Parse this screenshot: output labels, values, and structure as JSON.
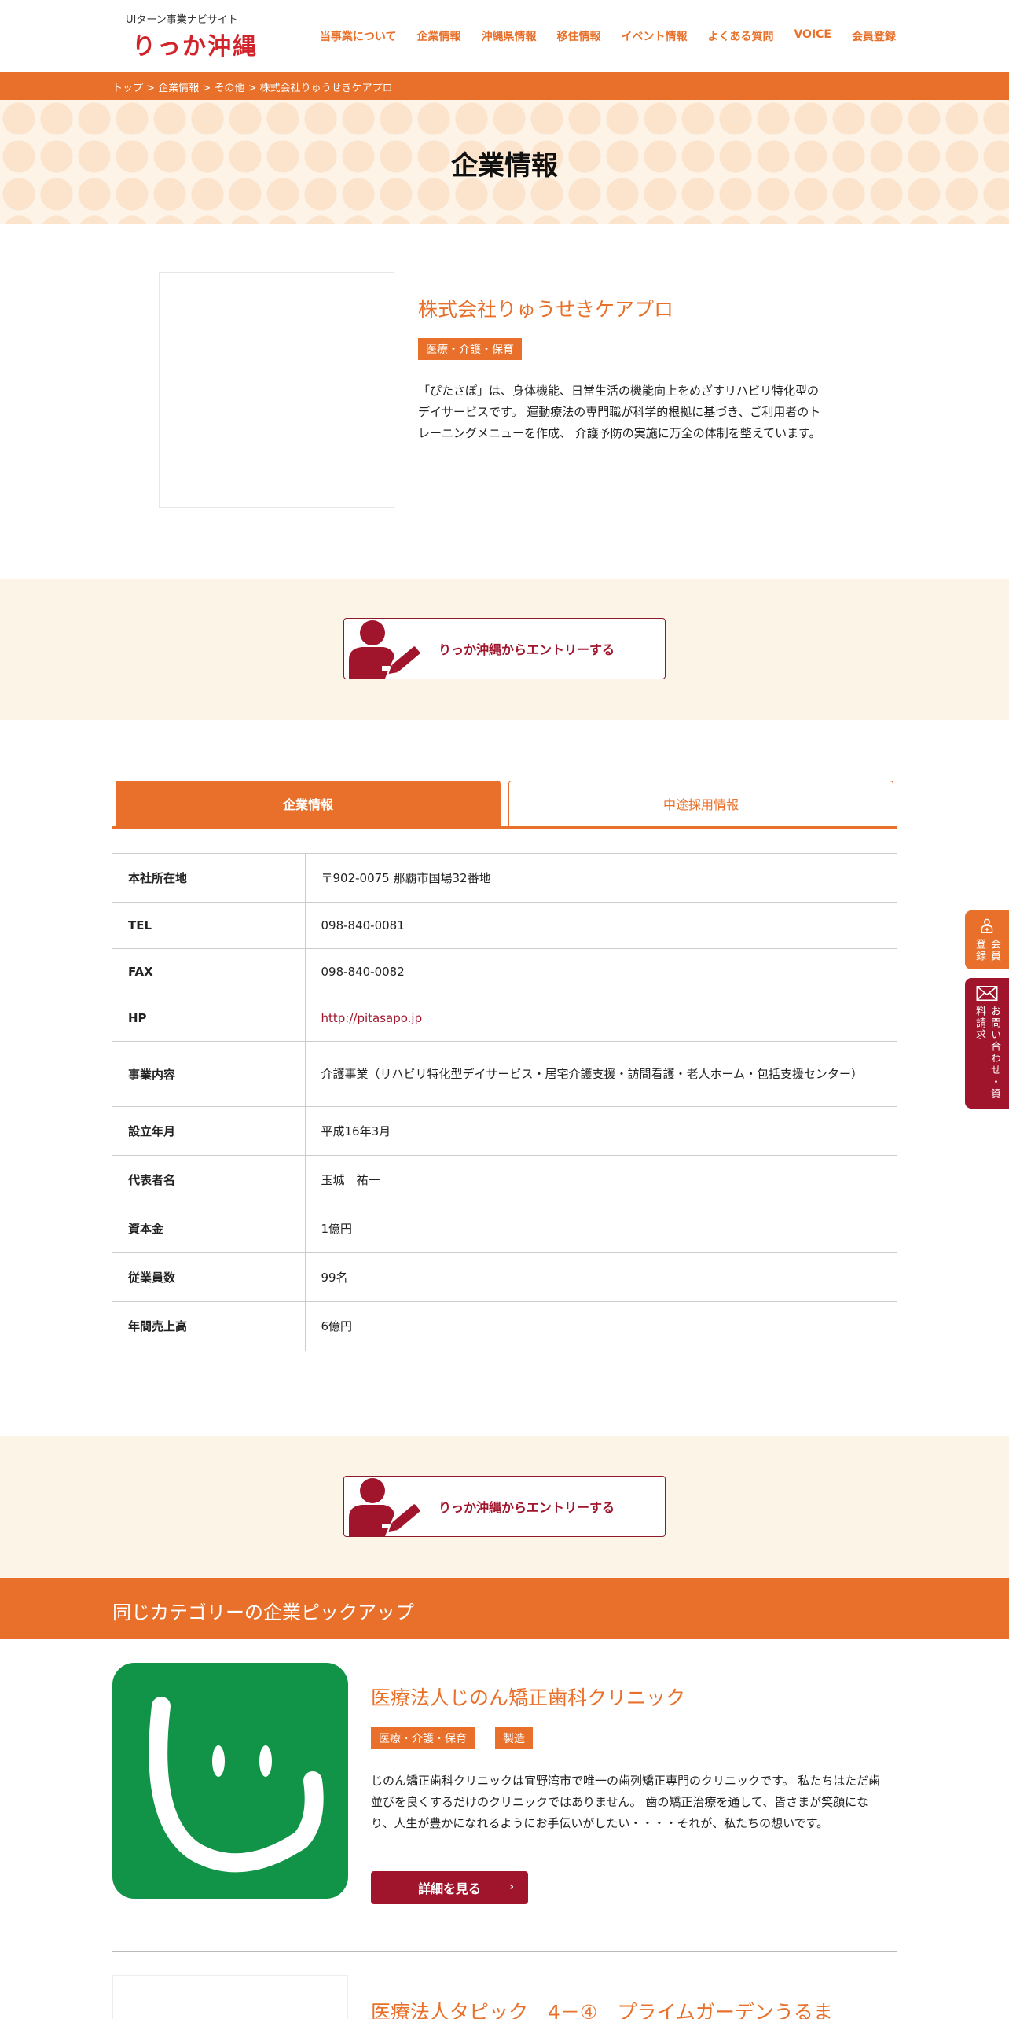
{
  "header": {
    "logo_sub": "UIターン事業ナビサイト",
    "logo_main": "りっか沖縄",
    "nav": [
      "当事業について",
      "企業情報",
      "沖縄県情報",
      "移住情報",
      "イベント情報",
      "よくある質問",
      "VOICE",
      "会員登録"
    ]
  },
  "breadcrumb": {
    "items": [
      "トップ",
      "企業情報",
      "その他",
      "株式会社りゅうせきケアプロ"
    ],
    "separator": ">"
  },
  "hero": {
    "title": "企業情報"
  },
  "company": {
    "name": "株式会社りゅうせきケアプロ",
    "tag": "医療・介護・保育",
    "intro": "「ぴたさぽ」は、身体機能、日常生活の機能向上をめざすリハビリ特化型のデイサービスです。 運動療法の専門職が科学的根拠に基づき、ご利用者のトレーニングメニューを作成、 介護予防の実施に万全の体制を整えています。"
  },
  "entry": {
    "label": "りっか沖縄からエントリーする"
  },
  "tabs": {
    "active": "企業情報",
    "inactive": "中途採用情報"
  },
  "info": {
    "rows": [
      {
        "label": "本社所在地",
        "value": "〒902-0075 那覇市国場32番地"
      },
      {
        "label": "TEL",
        "value": "098-840-0081"
      },
      {
        "label": "FAX",
        "value": "098-840-0082"
      },
      {
        "label": "HP",
        "value": "http://pitasapo.jp"
      },
      {
        "label": "事業内容",
        "value": "介護事業（リハビリ特化型デイサービス・居宅介護支援・訪問看護・老人ホーム・包括支援センター）"
      },
      {
        "label": "設立年月",
        "value": "平成16年3月"
      },
      {
        "label": "代表者名",
        "value": "玉城　祐一"
      },
      {
        "label": "資本金",
        "value": "1億円"
      },
      {
        "label": "従業員数",
        "value": "99名"
      },
      {
        "label": "年間売上高",
        "value": "6億円"
      }
    ]
  },
  "pickup": {
    "heading": "同じカテゴリーの企業ピックアップ",
    "items": [
      {
        "name": "医療法人じのん矯正歯科クリニック",
        "tags": [
          "医療・介護・保育",
          "製造"
        ],
        "desc": "じのん矯正歯科クリニックは宜野湾市で唯一の歯列矯正専門のクリニックです。 私たちはただ歯並びを良くするだけのクリニックではありません。 歯の矯正治療を通して、皆さまが笑顔になり、人生が豊かになれるようにお手伝いがしたい・・・・それが、私たちの想いです。",
        "button": "詳細を見る"
      },
      {
        "name": "医療法人タピック　4－④　プライムガーデンうるま"
      }
    ]
  },
  "side": {
    "entry_label": "会員登録",
    "contact_label": "お問い合わせ・資料請求"
  },
  "colors": {
    "accent": "#e8702a",
    "brand_red": "#a0152c",
    "cream": "#fdf4e8",
    "logo_green": "#119447"
  }
}
